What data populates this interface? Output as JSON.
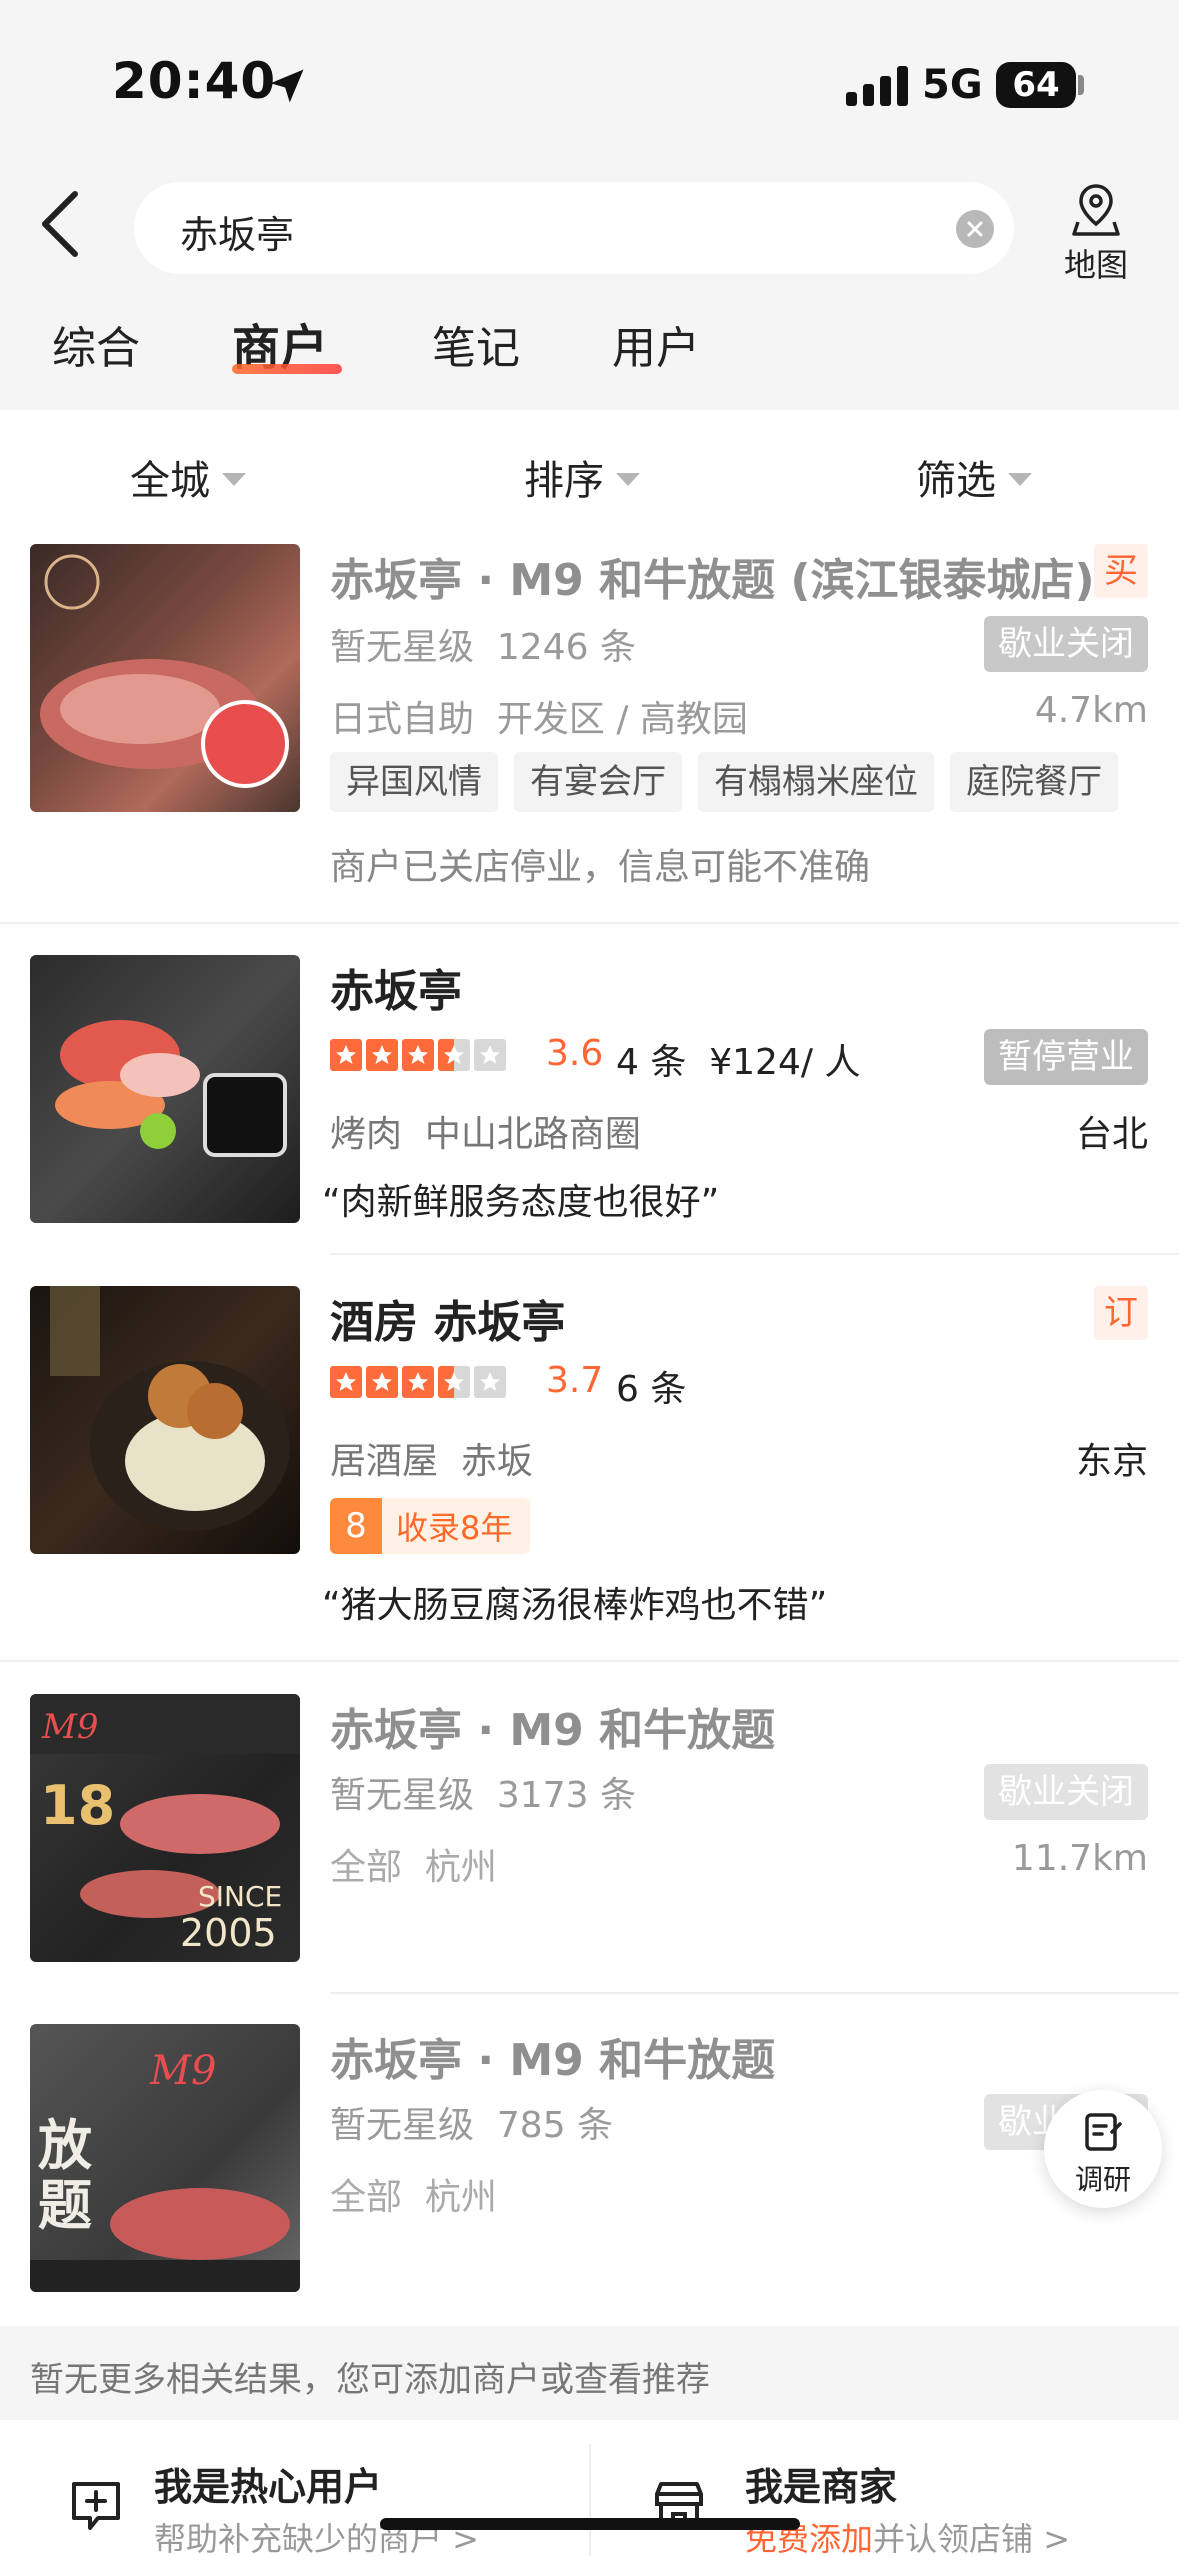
{
  "status_bar": {
    "time": "20:40",
    "network": "5G",
    "battery": "64"
  },
  "search": {
    "query": "赤坂亭",
    "map_label": "地图"
  },
  "tabs": [
    {
      "label": "综合"
    },
    {
      "label": "商户",
      "active": true
    },
    {
      "label": "笔记"
    },
    {
      "label": "用户"
    }
  ],
  "filters": [
    {
      "label": "全城"
    },
    {
      "label": "排序"
    },
    {
      "label": "筛选"
    }
  ],
  "results": [
    {
      "title": "赤坂亭 · M9 和牛放题 (滨江银泰城店)",
      "badge": "买",
      "rating_text": "暂无星级",
      "reviews": "1246 条",
      "status": "歇业关闭",
      "category": "日式自助",
      "area": "开发区 / 高教园",
      "distance": "4.7km",
      "tags": [
        "异国风情",
        "有宴会厅",
        "有榻榻米座位",
        "庭院餐厅"
      ],
      "notice": "商户已关店停业，信息可能不准确"
    },
    {
      "title": "赤坂亭",
      "rating": "3.6",
      "stars": 3.5,
      "reviews": "4 条",
      "price": "¥124/ 人",
      "status": "暂停营业",
      "category": "烤肉",
      "area": "中山北路商圈",
      "city": "台北",
      "quote": "“肉新鲜服务态度也很好”"
    },
    {
      "title": "酒房 赤坂亭",
      "badge": "订",
      "rating": "3.7",
      "stars": 3.5,
      "reviews": "6 条",
      "category": "居酒屋",
      "area": "赤坂",
      "city": "东京",
      "award_num": "8",
      "award_text": "收录8年",
      "quote": "“猪大肠豆腐汤很棒炸鸡也不错”"
    },
    {
      "title": "赤坂亭 · M9 和牛放题",
      "rating_text": "暂无星级",
      "reviews": "3173 条",
      "status": "歇业关闭",
      "category": "全部",
      "area": "杭州",
      "distance": "11.7km"
    },
    {
      "title": "赤坂亭 · M9 和牛放题",
      "rating_text": "暂无星级",
      "reviews": "785 条",
      "status": "歇业关闭",
      "category": "全部",
      "area": "杭州"
    }
  ],
  "float_button": {
    "label": "调研"
  },
  "footer": {
    "no_more": "暂无更多相关结果，您可添加商户或查看推荐",
    "user_cta": {
      "title": "我是热心用户",
      "sub": "帮助补充缺少的商户 >"
    },
    "merchant_cta": {
      "title": "我是商家",
      "sub_accent": "免费添加",
      "sub_rest": "并认领店铺 >"
    }
  },
  "colors": {
    "accent": "#ff6633",
    "closed_pill": "#c8c8c8",
    "star": "#ff6c3b"
  }
}
